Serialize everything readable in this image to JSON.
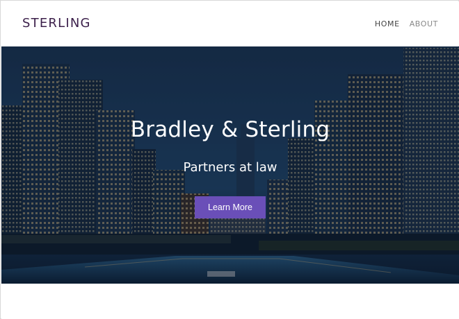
{
  "header": {
    "brand": "STERLING",
    "nav": [
      {
        "label": "HOME",
        "active": true
      },
      {
        "label": "ABOUT",
        "active": false
      }
    ]
  },
  "hero": {
    "title": "Bradley & Sterling",
    "subtitle": "Partners at law",
    "cta_label": "Learn More",
    "cta_color": "#6a4fb8",
    "background": "city-skyline-night-river"
  },
  "colors": {
    "brand": "#3b1f4a",
    "nav_active": "#444444",
    "nav_inactive": "#888888"
  }
}
